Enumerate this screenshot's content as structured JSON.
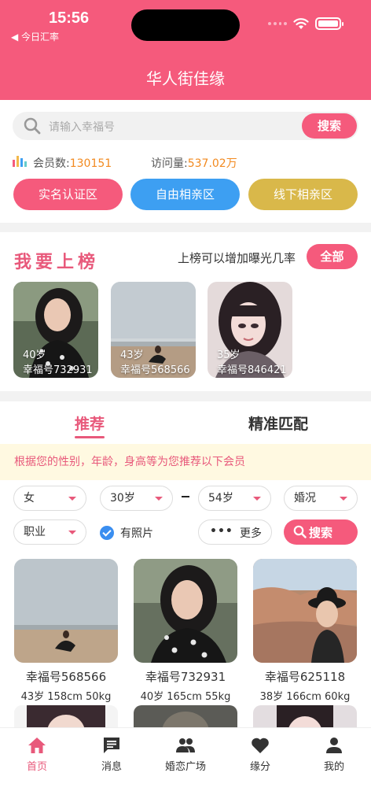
{
  "status_bar": {
    "time": "15:56",
    "back_app": "◀ 今日汇率"
  },
  "app_title": "华人街佳缘",
  "search": {
    "placeholder": "请输入幸福号",
    "button": "搜索"
  },
  "stats": {
    "members_label": "会员数:",
    "members_value": "130151",
    "visits_label": "访问量:",
    "visits_value": "537.02万"
  },
  "zones": [
    {
      "label": "实名认证区",
      "color": "#f55a7c"
    },
    {
      "label": "自由相亲区",
      "color": "#3d9ff2"
    },
    {
      "label": "线下相亲区",
      "color": "#d9b84a"
    }
  ],
  "ranking": {
    "title": "我要上榜",
    "tip": "上榜可以增加曝光几率",
    "all_button": "全部",
    "photos": [
      {
        "age": "40岁",
        "number": "幸福号732931"
      },
      {
        "age": "43岁",
        "number": "幸福号568566"
      },
      {
        "age": "35岁",
        "number": "幸福号846421"
      }
    ]
  },
  "recommend": {
    "tabs": [
      "推荐",
      "精准匹配"
    ],
    "notice": "根据您的性别，年龄，身高等为您推荐以下会员",
    "filters": {
      "gender": "女",
      "age_min": "30岁",
      "age_max": "54岁",
      "marital": "婚况",
      "job": "职业",
      "has_photo": "有照片",
      "more_dots": "•••",
      "more": "更多",
      "search": "搜索"
    },
    "members": [
      {
        "number": "幸福号568566",
        "info": "43岁 158cm 50kg"
      },
      {
        "number": "幸福号732931",
        "info": "40岁 165cm 55kg"
      },
      {
        "number": "幸福号625118",
        "info": "38岁 166cm 60kg"
      }
    ]
  },
  "tabbar": [
    {
      "label": "首页",
      "icon": "home-icon"
    },
    {
      "label": "消息",
      "icon": "message-icon"
    },
    {
      "label": "婚恋广场",
      "icon": "people-icon"
    },
    {
      "label": "缘分",
      "icon": "heart-icon"
    },
    {
      "label": "我的",
      "icon": "profile-icon"
    }
  ],
  "colors": {
    "brand": "#f55a7c",
    "accent_text": "#e8597b",
    "stat_value": "#f28a20"
  }
}
